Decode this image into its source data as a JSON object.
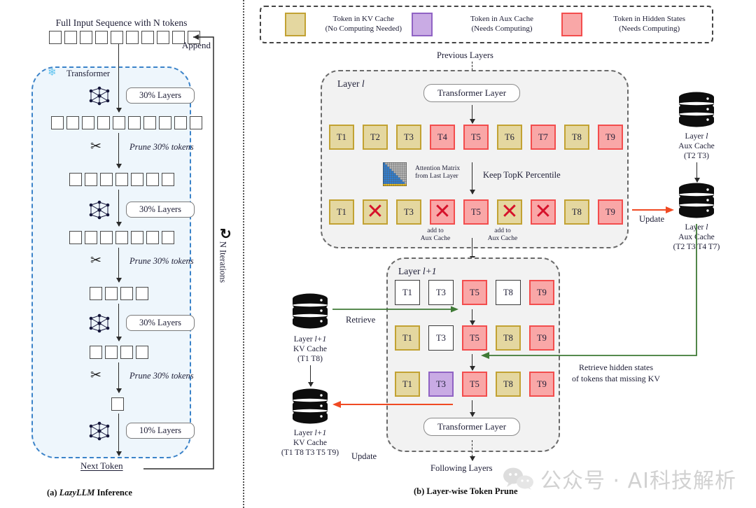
{
  "panel_a": {
    "caption_prefix": "(a) ",
    "caption_italic": "LazyLLM",
    "caption_suffix": " Inference",
    "input_title": "Full Input Sequence with N tokens",
    "append_label": "Append",
    "transformer_label": "Transformer",
    "next_token_label": "Next Token",
    "iterations_label": "N Iterations",
    "snow_icon": "snowflake-icon",
    "refresh_icon": "circular-arrow-icon",
    "rows": [
      {
        "count": 10
      },
      {
        "count": 10
      },
      {
        "count": 7
      },
      {
        "count": 7
      },
      {
        "count": 4
      },
      {
        "count": 4
      },
      {
        "count": 1
      }
    ],
    "layer_pills": [
      "30% Layers",
      "30% Layers",
      "30% Layers",
      "10% Layers"
    ],
    "prune_labels": [
      "Prune 30% tokens",
      "Prune 30% tokens",
      "Prune 30% tokens"
    ]
  },
  "panel_b": {
    "caption_prefix": "(b) ",
    "caption_text": "Layer-wise Token Prune",
    "legend": [
      {
        "swatch": "kv",
        "line1": "Token in KV Cache",
        "line2": "(No Computing Needed)",
        "fill": "#e4d7a0",
        "border": "#c2a233"
      },
      {
        "swatch": "aux",
        "line1": "Token in Aux Cache",
        "line2": "(Needs Computing)",
        "fill": "#c9abe4",
        "border": "#9063c4"
      },
      {
        "swatch": "hid",
        "line1": "Token in Hidden States",
        "line2": "(Needs Computing)",
        "fill": "#f9a7a7",
        "border": "#f34d4d"
      }
    ],
    "previous_layers": "Previous Layers",
    "following_layers": "Following Layers",
    "layer_l": {
      "name_prefix": "Layer ",
      "name_italic": "l",
      "transformer_layer": "Transformer Layer",
      "row_top": [
        {
          "label": "T1",
          "type": "kv"
        },
        {
          "label": "T2",
          "type": "kv"
        },
        {
          "label": "T3",
          "type": "kv"
        },
        {
          "label": "T4",
          "type": "hid"
        },
        {
          "label": "T5",
          "type": "hid"
        },
        {
          "label": "T6",
          "type": "kv"
        },
        {
          "label": "T7",
          "type": "hid"
        },
        {
          "label": "T8",
          "type": "kv"
        },
        {
          "label": "T9",
          "type": "hid"
        }
      ],
      "row_bottom": [
        {
          "label": "T1",
          "type": "kv",
          "pruned": false
        },
        {
          "label": "T2",
          "type": "kv",
          "pruned": true
        },
        {
          "label": "T3",
          "type": "kv",
          "pruned": false
        },
        {
          "label": "T4",
          "type": "hid",
          "pruned": true
        },
        {
          "label": "T5",
          "type": "hid",
          "pruned": false
        },
        {
          "label": "T6",
          "type": "kv",
          "pruned": true
        },
        {
          "label": "T7",
          "type": "hid",
          "pruned": true
        },
        {
          "label": "T8",
          "type": "kv",
          "pruned": false
        },
        {
          "label": "T9",
          "type": "hid",
          "pruned": false
        }
      ],
      "attention_matrix_line1": "Attention Matrix",
      "attention_matrix_line2": "from Last Layer",
      "keep_topk": "Keep TopK Percentile",
      "add_to_aux_1_line1": "add to",
      "add_to_aux_1_line2": "Aux Cache",
      "add_to_aux_2_line1": "add to",
      "add_to_aux_2_line2": "Aux Cache"
    },
    "layer_l1": {
      "name_prefix": "Layer ",
      "name_italic": "l+1",
      "transformer_layer": "Transformer Layer",
      "row1": [
        {
          "label": "T1",
          "type": "empty"
        },
        {
          "label": "T3",
          "type": "empty"
        },
        {
          "label": "T5",
          "type": "hid"
        },
        {
          "label": "T8",
          "type": "empty"
        },
        {
          "label": "T9",
          "type": "hid"
        }
      ],
      "row2": [
        {
          "label": "T1",
          "type": "kv"
        },
        {
          "label": "T3",
          "type": "empty"
        },
        {
          "label": "T5",
          "type": "hid"
        },
        {
          "label": "T8",
          "type": "kv"
        },
        {
          "label": "T9",
          "type": "hid"
        }
      ],
      "row3": [
        {
          "label": "T1",
          "type": "kv"
        },
        {
          "label": "T3",
          "type": "aux"
        },
        {
          "label": "T5",
          "type": "hid"
        },
        {
          "label": "T8",
          "type": "kv"
        },
        {
          "label": "T9",
          "type": "hid"
        }
      ]
    },
    "caches": {
      "aux_top": {
        "l1": "Layer l",
        "l2": "Aux Cache",
        "l3": "(T2 T3)",
        "prefix": "Layer ",
        "italic": "l"
      },
      "aux_bottom": {
        "l1": "Layer l",
        "l2": "Aux Cache",
        "l3": "(T2 T3 T4 T7)",
        "prefix": "Layer ",
        "italic": "l"
      },
      "kv_top": {
        "l1": "Layer l+1",
        "l2": "KV Cache",
        "l3": "(T1 T8)",
        "prefix": "Layer ",
        "italic": "l+1"
      },
      "kv_bottom": {
        "l1": "Layer l+1",
        "l2": "KV Cache",
        "l3": "(T1 T8 T3 T5 T9)",
        "prefix": "Layer ",
        "italic": "l+1"
      }
    },
    "arrows": {
      "update_right": "Update",
      "retrieve": "Retrieve",
      "update_left": "Update",
      "retrieve_hidden_l1": "Retrieve hidden states",
      "retrieve_hidden_l2": "of tokens that missing KV"
    },
    "colors": {
      "kv_fill": "#e4d7a0",
      "kv_border": "#c2a233",
      "hid_fill": "#f9a7a7",
      "hid_border": "#f34d4d",
      "aux_fill": "#c9abe4",
      "aux_border": "#9063c4",
      "update_arrow": "#f04a23",
      "retrieve_arrow": "#3f7a36",
      "panel_bg": "#f2f2f2",
      "dash_blue": "#3b83c9"
    }
  },
  "watermark": {
    "text": "公众号 · AI科技解析",
    "icon": "wechat-icon"
  }
}
